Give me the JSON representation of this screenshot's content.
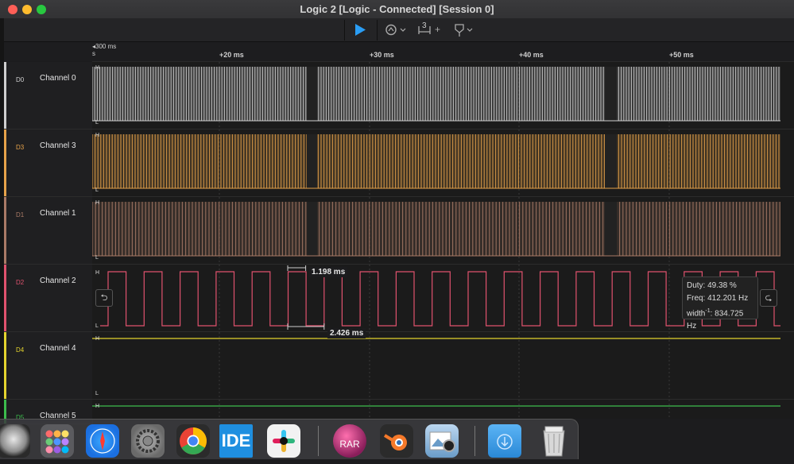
{
  "window": {
    "title": "Logic 2 [Logic - Connected] [Session 0]"
  },
  "toolbar": {
    "play_icon": "play-icon",
    "trigger_icon": "trigger-icon",
    "measure_label": "3",
    "measure_plus": "+",
    "marker_icon": "marker-icon"
  },
  "ruler": {
    "origin_top": "300 ms",
    "origin_bottom": "s",
    "ticks": [
      {
        "label": "+20 ms"
      },
      {
        "label": "+30 ms"
      },
      {
        "label": "+40 ms"
      },
      {
        "label": "+50 ms"
      }
    ]
  },
  "levels": {
    "high": "H",
    "low": "L"
  },
  "channels": [
    {
      "id": "D0",
      "name": "Channel 0",
      "color": "#cfcfcf"
    },
    {
      "id": "D3",
      "name": "Channel 3",
      "color": "#e6a24a"
    },
    {
      "id": "D1",
      "name": "Channel 1",
      "color": "#a97a66"
    },
    {
      "id": "D2",
      "name": "Channel 2",
      "color": "#e0526e"
    },
    {
      "id": "D4",
      "name": "Channel 4",
      "color": "#e4d42e"
    },
    {
      "id": "D5",
      "name": "Channel 5",
      "color": "#3cbc4c"
    }
  ],
  "measurements": {
    "pulse_width": "1.198 ms",
    "period": "2.426 ms",
    "tooltip": {
      "duty": "Duty: 49.38 %",
      "freq": "Freq: 412.201 Hz",
      "width": "width",
      "width_sup": "-1",
      "width_value": ": 834.725 Hz"
    }
  },
  "dock": {
    "apps": [
      {
        "name": "Launchpad"
      },
      {
        "name": "Apps"
      },
      {
        "name": "Safari"
      },
      {
        "name": "System Settings"
      },
      {
        "name": "Chrome"
      },
      {
        "name": "IDE",
        "label": "IDE"
      },
      {
        "name": "Slack"
      },
      {
        "name": "RAR",
        "label": "RAR"
      },
      {
        "name": "Blender"
      },
      {
        "name": "Preview"
      },
      {
        "name": "Downloads"
      },
      {
        "name": "Trash"
      }
    ]
  }
}
